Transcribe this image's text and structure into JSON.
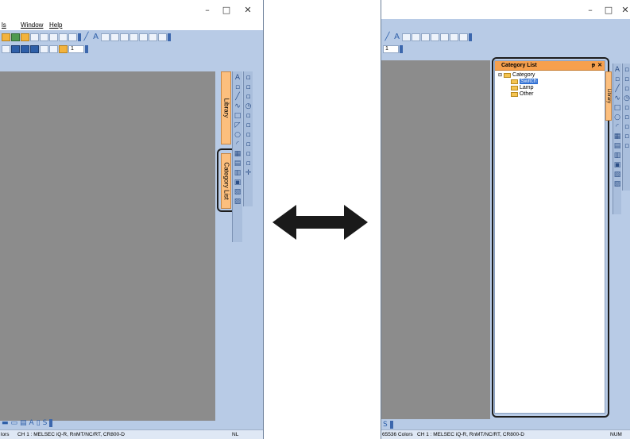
{
  "left_window": {
    "controls": {
      "minimize": "–",
      "maximize": "□",
      "close": "✕"
    },
    "menu": [
      {
        "label": "ls"
      },
      {
        "label": "Window"
      },
      {
        "label": "Help"
      }
    ],
    "toolbar_dropdown_value": "1",
    "docked_tabs": {
      "library": "Library",
      "category_list": "Category List"
    },
    "status": {
      "colors": "lors",
      "channel": "CH 1 : MELSEC iQ-R, RnMT/NC/RT, CR800-D",
      "indicator": "NL"
    }
  },
  "right_window": {
    "controls": {
      "minimize": "–",
      "maximize": "□",
      "close": "✕"
    },
    "toolbar_dropdown_value": "1",
    "panel": {
      "title": "Category List",
      "pin": "ᵽ",
      "close": "✕",
      "tree": {
        "root": "Category",
        "children": [
          {
            "label": "Switch",
            "selected": true
          },
          {
            "label": "Lamp",
            "selected": false
          },
          {
            "label": "Other",
            "selected": false
          }
        ]
      }
    },
    "docked_tab": "Library",
    "status": {
      "colors": "65536 Colors",
      "channel": "CH 1 : MELSEC iQ-R, RnMT/NC/RT, CR800-D",
      "indicator": "NUM"
    }
  },
  "arrow": {
    "symbol": "double-headed-arrow",
    "color": "#1a1a1a"
  },
  "colors": {
    "window_bg": "#b8cbe6",
    "canvas": "#8c8c8c",
    "panel_title": "#f6a04e",
    "tab_orange": "#fcbf7e",
    "selection": "#2f6fd3"
  }
}
